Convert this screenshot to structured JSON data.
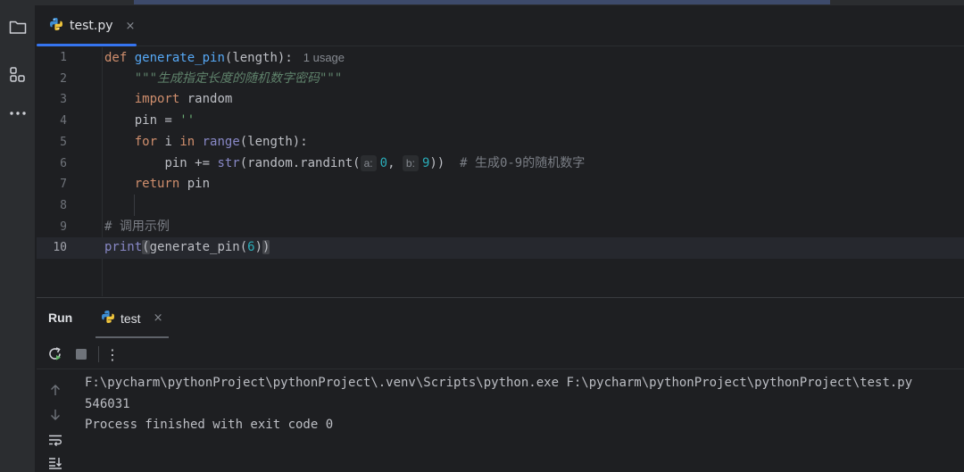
{
  "editor": {
    "tab": {
      "label": "test.py",
      "close": "×"
    },
    "usage_hint": "1 usage",
    "lines": [
      {
        "n": "1"
      },
      {
        "n": "2"
      },
      {
        "n": "3"
      },
      {
        "n": "4"
      },
      {
        "n": "5"
      },
      {
        "n": "6"
      },
      {
        "n": "7"
      },
      {
        "n": "8"
      },
      {
        "n": "9"
      },
      {
        "n": "10"
      }
    ],
    "code": {
      "l1_kw": "def",
      "l1_fn": "generate_pin",
      "l1_rest": "(length):",
      "l2_doc": "\"\"\"生成指定长度的随机数字密码\"\"\"",
      "l3_kw": "import",
      "l3_rest": " random",
      "l4_a": "pin = ",
      "l4_str": "''",
      "l5_kw1": "for",
      "l5_mid": " i ",
      "l5_kw2": "in",
      "l5_sp": " ",
      "l5_bi": "range",
      "l5_rest": "(length):",
      "l6_a": "pin += ",
      "l6_bi": "str",
      "l6_b": "(random.randint(",
      "l6_hint_a": "a:",
      "l6_num_a": "0",
      "l6_comma": ", ",
      "l6_hint_b": "b:",
      "l6_num_b": "9",
      "l6_close": "))",
      "l6_comment": "  # 生成0-9的随机数字",
      "l7_kw": "return",
      "l7_rest": " pin",
      "l9_comment": "# 调用示例",
      "l10_bi": "print",
      "l10_open": "(",
      "l10_mid": "generate_pin(",
      "l10_num": "6",
      "l10_close1": ")",
      "l10_close2": ")"
    }
  },
  "run": {
    "title": "Run",
    "tab": {
      "label": "test",
      "close": "×"
    },
    "toolbar": {
      "rerun": "rerun-icon",
      "stop": "stop-icon",
      "more": "⋮"
    },
    "console": [
      "F:\\pycharm\\pythonProject\\pythonProject\\.venv\\Scripts\\python.exe F:\\pycharm\\pythonProject\\pythonProject\\test.py",
      "546031",
      "",
      "Process finished with exit code 0"
    ]
  },
  "activity_bar": [
    "folder-icon",
    "structure-icon",
    "more-icon"
  ],
  "colors": {
    "accent": "#3574f0",
    "background": "#1e1f22",
    "panel": "#2b2d30"
  }
}
